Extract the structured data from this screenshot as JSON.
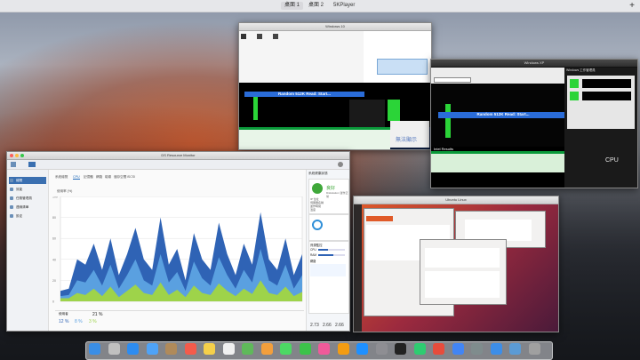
{
  "menubar": {
    "spaces": [
      "桌面 1",
      "桌面 2",
      "5KPlayer"
    ],
    "active_space": "桌面 1",
    "add_space_label": "+"
  },
  "window_main": {
    "title": "DS Resource Monitor",
    "sidebar_items": [
      {
        "label": "總覽",
        "icon": "overview-icon"
      },
      {
        "label": "效能",
        "icon": "performance-icon"
      },
      {
        "label": "任務管理員",
        "icon": "task-icon"
      },
      {
        "label": "連線清單",
        "icon": "connection-icon"
      },
      {
        "label": "設定",
        "icon": "settings-icon"
      }
    ],
    "tabs": [
      "系統總覽",
      "CPU",
      "記憶體",
      "網路",
      "磁碟",
      "儲存空間",
      "iSCSI"
    ],
    "active_tab": "CPU",
    "chart_label": "使用率 (%)",
    "y_ticks": [
      "100",
      "80",
      "60",
      "40",
      "20",
      "0"
    ],
    "legend_values": [
      "使用者",
      "系統",
      "I/O"
    ],
    "summary_values": [
      "12 %",
      "8 %",
      "3 %"
    ],
    "load_label": "21 %",
    "status_panel": {
      "title": "系統健康狀態",
      "status_text": "良好",
      "status_sub": "Diskstation 運作正常",
      "details": [
        "IP 位址",
        "伺服器名稱",
        "運作時間",
        "溫度"
      ],
      "resource_title": "資源監控",
      "cpu_label": "CPU",
      "ram_label": "RAM",
      "net_label": "網路",
      "cpu_percent": 0.35,
      "ram_percent": 0.55,
      "load_values": [
        "2.73",
        "2.66",
        "2.66"
      ]
    }
  },
  "window_bench_top": {
    "title": "Windows 10",
    "banner": "Random 512K Read: Start...",
    "watermark": "無法顯示"
  },
  "window_bench_right": {
    "title": "Windows XP",
    "banner": "Random 512K Read: Start...",
    "results_label": "Intel Results",
    "task_title": "Windows 工作管理員",
    "watermark": "CPU"
  },
  "window_ubuntu": {
    "title": "Ubuntu Linux"
  },
  "chart_data": {
    "type": "area",
    "title": "",
    "xlabel": "",
    "ylabel": "使用率 (%)",
    "ylim": [
      0,
      100
    ],
    "series": [
      {
        "values": [
          10,
          12,
          40,
          35,
          55,
          30,
          60,
          25,
          45,
          70,
          40,
          30,
          80,
          35,
          50,
          20,
          65,
          40,
          30,
          75,
          45,
          25,
          55,
          35,
          85,
          40,
          30,
          60,
          25,
          45
        ]
      },
      {
        "values": [
          5,
          6,
          20,
          18,
          30,
          15,
          35,
          12,
          25,
          40,
          20,
          15,
          45,
          18,
          28,
          10,
          38,
          22,
          15,
          42,
          25,
          12,
          30,
          18,
          50,
          20,
          15,
          35,
          12,
          25
        ]
      },
      {
        "values": [
          3,
          3,
          8,
          6,
          12,
          5,
          14,
          4,
          10,
          16,
          8,
          6,
          18,
          6,
          11,
          4,
          15,
          8,
          6,
          17,
          10,
          5,
          12,
          7,
          20,
          8,
          6,
          14,
          5,
          9
        ]
      }
    ],
    "colors": [
      "#2f63b5",
      "#5aa0e0",
      "#9ed34a"
    ]
  },
  "dock": {
    "icons": [
      "finder-icon",
      "launchpad-icon",
      "safari-icon",
      "mail-icon",
      "contacts-icon",
      "calendar-icon",
      "notes-icon",
      "reminders-icon",
      "maps-icon",
      "photos-icon",
      "messages-icon",
      "facetime-icon",
      "itunes-icon",
      "ibooks-icon",
      "appstore-icon",
      "preferences-icon",
      "terminal-icon",
      "activity-icon",
      "5kplayer-icon",
      "chrome-icon",
      "vm-icon",
      "folder-icon",
      "downloads-icon",
      "trash-icon"
    ]
  }
}
